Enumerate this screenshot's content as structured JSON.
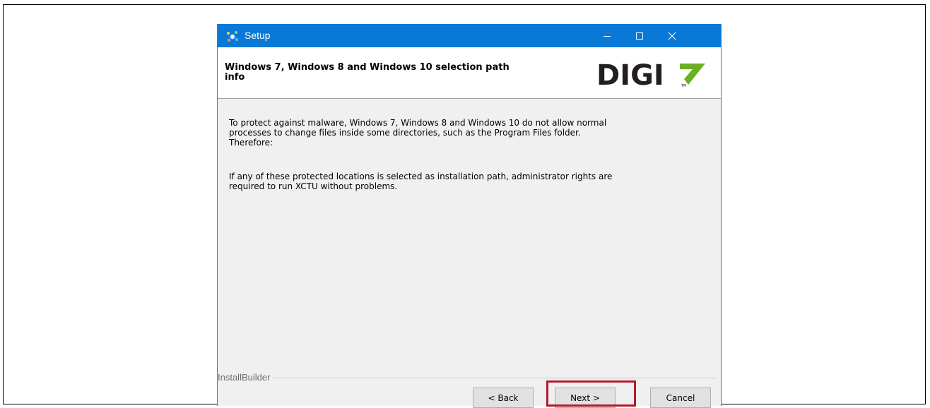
{
  "window": {
    "title": "Setup",
    "icon": "installer-app-icon",
    "controls": {
      "minimize": "minimize-icon",
      "maximize": "maximize-icon",
      "close": "close-icon"
    }
  },
  "header": {
    "title": "Windows 7, Windows 8 and Windows 10 selection path\ninfo",
    "logo_text": "DIGI",
    "logo_mark": "TM",
    "logo_accent_color": "#6ab023"
  },
  "body": {
    "paragraph1": "To protect against malware, Windows 7, Windows 8 and Windows 10 do not allow normal\nprocesses to change files inside some directories, such as the Program Files folder.\nTherefore:",
    "paragraph2": "If any of these protected locations is selected as installation path, administrator rights are\nrequired to run XCTU without problems."
  },
  "footer": {
    "brand": "InstallBuilder",
    "buttons": {
      "back": "< Back",
      "next": "Next >",
      "cancel": "Cancel"
    }
  },
  "colors": {
    "titlebar": "#0a78d7",
    "highlight": "#b01c2c"
  }
}
